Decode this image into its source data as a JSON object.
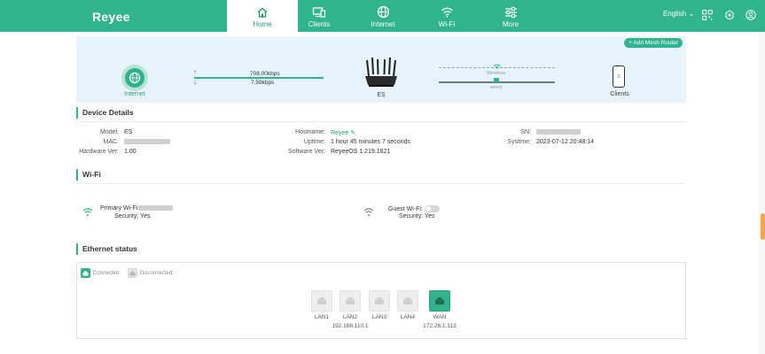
{
  "app": {
    "logo": "Reyee"
  },
  "nav": {
    "tabs": [
      {
        "label": "Home",
        "icon": "home-icon",
        "active": true
      },
      {
        "label": "Clients",
        "icon": "clients-icon",
        "active": false
      },
      {
        "label": "Internet",
        "icon": "globe-icon",
        "active": false
      },
      {
        "label": "Wi-Fi",
        "icon": "wifi-icon",
        "active": false
      },
      {
        "label": "More",
        "icon": "sliders-icon",
        "active": false
      }
    ],
    "language": "English"
  },
  "topology": {
    "add_mesh_label": "+ Add Mesh Router",
    "internet_label": "Internet",
    "upload_speed": "708.00kbps",
    "download_speed": "7.59kbps",
    "router_label": "ES",
    "wireless_label": "Wireless",
    "wired_label": "wired",
    "clients_label": "Clients",
    "clients_count": "0"
  },
  "device_details": {
    "title": "Device Details",
    "model_key": "Model:",
    "model_val": "ES",
    "mac_key": "MAC:",
    "hw_key": "Hardware Ver:",
    "hw_val": "1.00",
    "hostname_key": "Hostname:",
    "hostname_val": "Reyee",
    "uptime_key": "Uptime:",
    "uptime_val": "1 hour 45 minutes 7 seconds",
    "sw_key": "Software Ver:",
    "sw_val": "ReyeeOS 1.219.1821",
    "sn_key": "SN:",
    "systime_key": "Systime:",
    "systime_val": "2023-07-12 20:48:14"
  },
  "wifi": {
    "title": "Wi-Fi",
    "primary_label": "Primary Wi-Fi:",
    "primary_security": "Security: Yes",
    "guest_label": "Guest Wi-Fi:",
    "guest_security": "Security: Yes"
  },
  "ethernet": {
    "title": "Ethernet status",
    "legend_connected": "Connected",
    "legend_disconnected": "Disconnected",
    "ports": [
      {
        "name": "LAN1",
        "ip": "",
        "connected": false
      },
      {
        "name": "LAN2",
        "ip": "192.168.110.1",
        "connected": false
      },
      {
        "name": "LAN3",
        "ip": "",
        "connected": false
      },
      {
        "name": "LAN4",
        "ip": "",
        "connected": false
      },
      {
        "name": "WAN",
        "ip": "172.26.1.113",
        "connected": true
      }
    ]
  },
  "colors": {
    "brand": "#31b38d",
    "topology_bg": "#e7f4fb"
  }
}
